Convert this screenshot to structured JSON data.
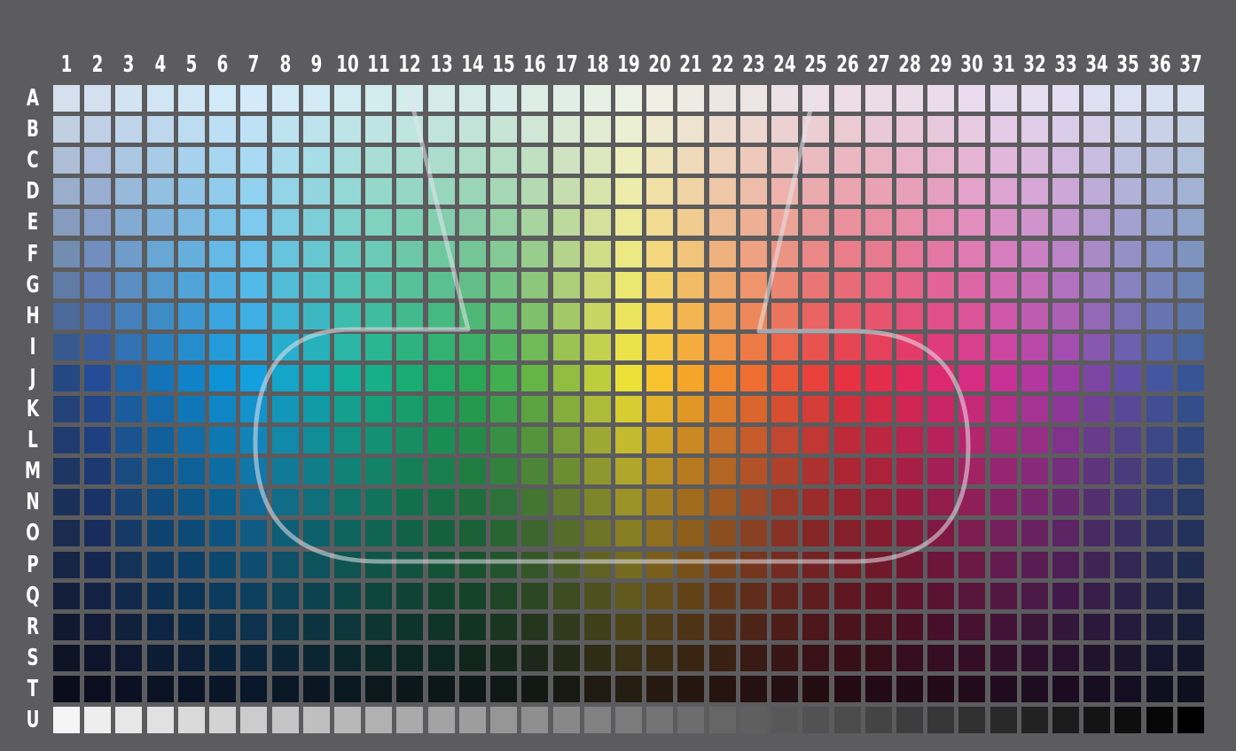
{
  "columns": [
    "1",
    "2",
    "3",
    "4",
    "5",
    "6",
    "7",
    "8",
    "9",
    "10",
    "11",
    "12",
    "13",
    "14",
    "15",
    "16",
    "17",
    "18",
    "19",
    "20",
    "21",
    "22",
    "23",
    "24",
    "25",
    "26",
    "27",
    "28",
    "29",
    "30",
    "31",
    "32",
    "33",
    "34",
    "35",
    "36",
    "37"
  ],
  "rows": [
    "A",
    "B",
    "C",
    "D",
    "E",
    "F",
    "G",
    "H",
    "I",
    "J",
    "K",
    "L",
    "M",
    "N",
    "O",
    "P",
    "Q",
    "R",
    "S",
    "T",
    "U"
  ],
  "colors": {
    "background": "#5c5c5e",
    "label": "#ffffff",
    "gamut_outline": "#e6e6ec"
  },
  "hue_anchors": [
    [
      37,
      72,
      130
    ],
    [
      36,
      76,
      150
    ],
    [
      30,
      100,
      170
    ],
    [
      20,
      115,
      185
    ],
    [
      16,
      130,
      200
    ],
    [
      14,
      146,
      214
    ],
    [
      20,
      160,
      222
    ],
    [
      20,
      165,
      200
    ],
    [
      18,
      170,
      180
    ],
    [
      20,
      175,
      155
    ],
    [
      22,
      175,
      135
    ],
    [
      25,
      172,
      115
    ],
    [
      30,
      170,
      100
    ],
    [
      40,
      168,
      85
    ],
    [
      65,
      175,
      80
    ],
    [
      100,
      180,
      70
    ],
    [
      145,
      190,
      65
    ],
    [
      190,
      205,
      60
    ],
    [
      235,
      225,
      55
    ],
    [
      248,
      195,
      45
    ],
    [
      245,
      165,
      40
    ],
    [
      240,
      135,
      45
    ],
    [
      238,
      110,
      50
    ],
    [
      235,
      85,
      55
    ],
    [
      232,
      65,
      60
    ],
    [
      230,
      50,
      65
    ],
    [
      228,
      45,
      75
    ],
    [
      225,
      40,
      90
    ],
    [
      220,
      40,
      110
    ],
    [
      215,
      45,
      130
    ],
    [
      200,
      50,
      150
    ],
    [
      180,
      55,
      160
    ],
    [
      155,
      60,
      165
    ],
    [
      125,
      70,
      165
    ],
    [
      95,
      80,
      165
    ],
    [
      70,
      85,
      160
    ],
    [
      55,
      85,
      150
    ]
  ]
}
